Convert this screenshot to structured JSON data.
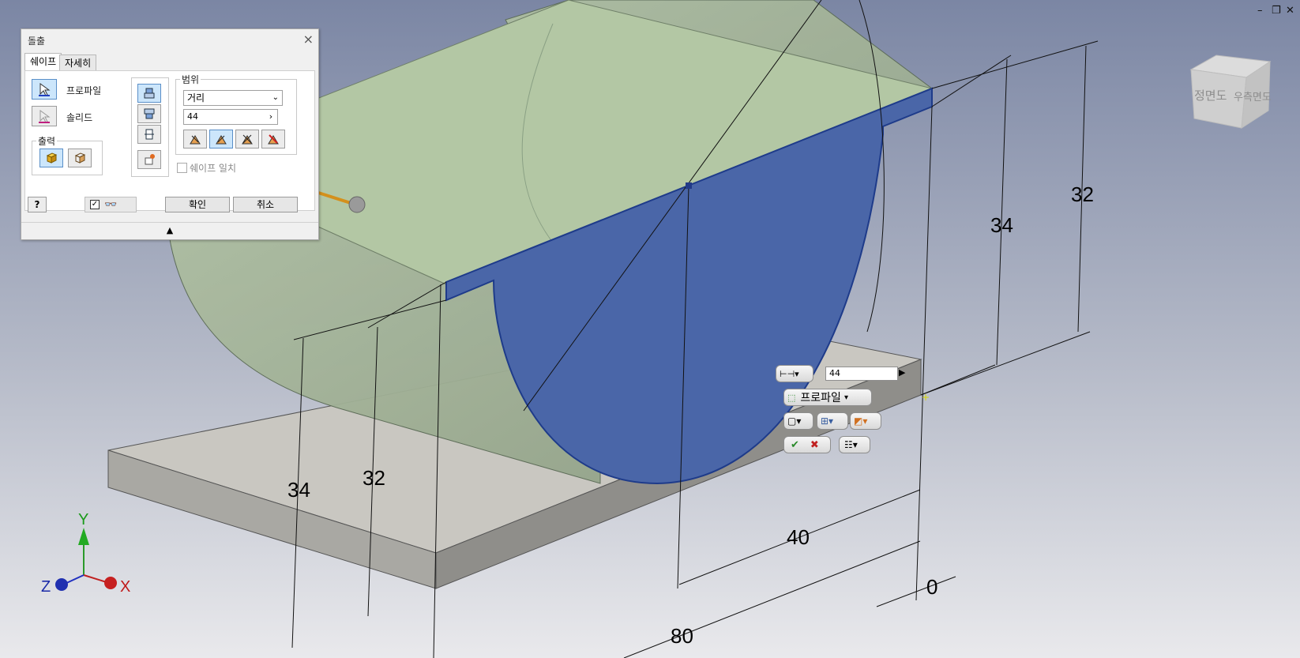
{
  "window_controls": {
    "minimize": "–",
    "restore": "❐",
    "close": "✕"
  },
  "viewcube": {
    "face_front": "정면도",
    "face_right": "우측면도"
  },
  "dimensions": [
    "34",
    "32",
    "34",
    "32",
    "40",
    "80",
    "0"
  ],
  "axes": {
    "x": "X",
    "y": "Y",
    "z": "Z"
  },
  "dialog": {
    "title": "돌출",
    "tabs": [
      "쉐이프",
      "자세히"
    ],
    "profile_label": "프로파일",
    "solid_label": "솔리드",
    "output_label": "출력",
    "range_label": "범위",
    "range_value": "거리",
    "distance_value": "44",
    "match_shape_label": "쉐이프 일치",
    "ok_label": "확인",
    "cancel_label": "취소"
  },
  "minitoolbar": {
    "distance_value": "44",
    "profile_label": "프로파일"
  },
  "colors": {
    "background_top": "#7b86a4",
    "background_bottom": "#e9e9ec",
    "profile_fill": "#4a66a8",
    "cylinder_fill": "#a9bc9a",
    "base_fill": "#c3c1ba",
    "accent": "#cce6fb"
  }
}
